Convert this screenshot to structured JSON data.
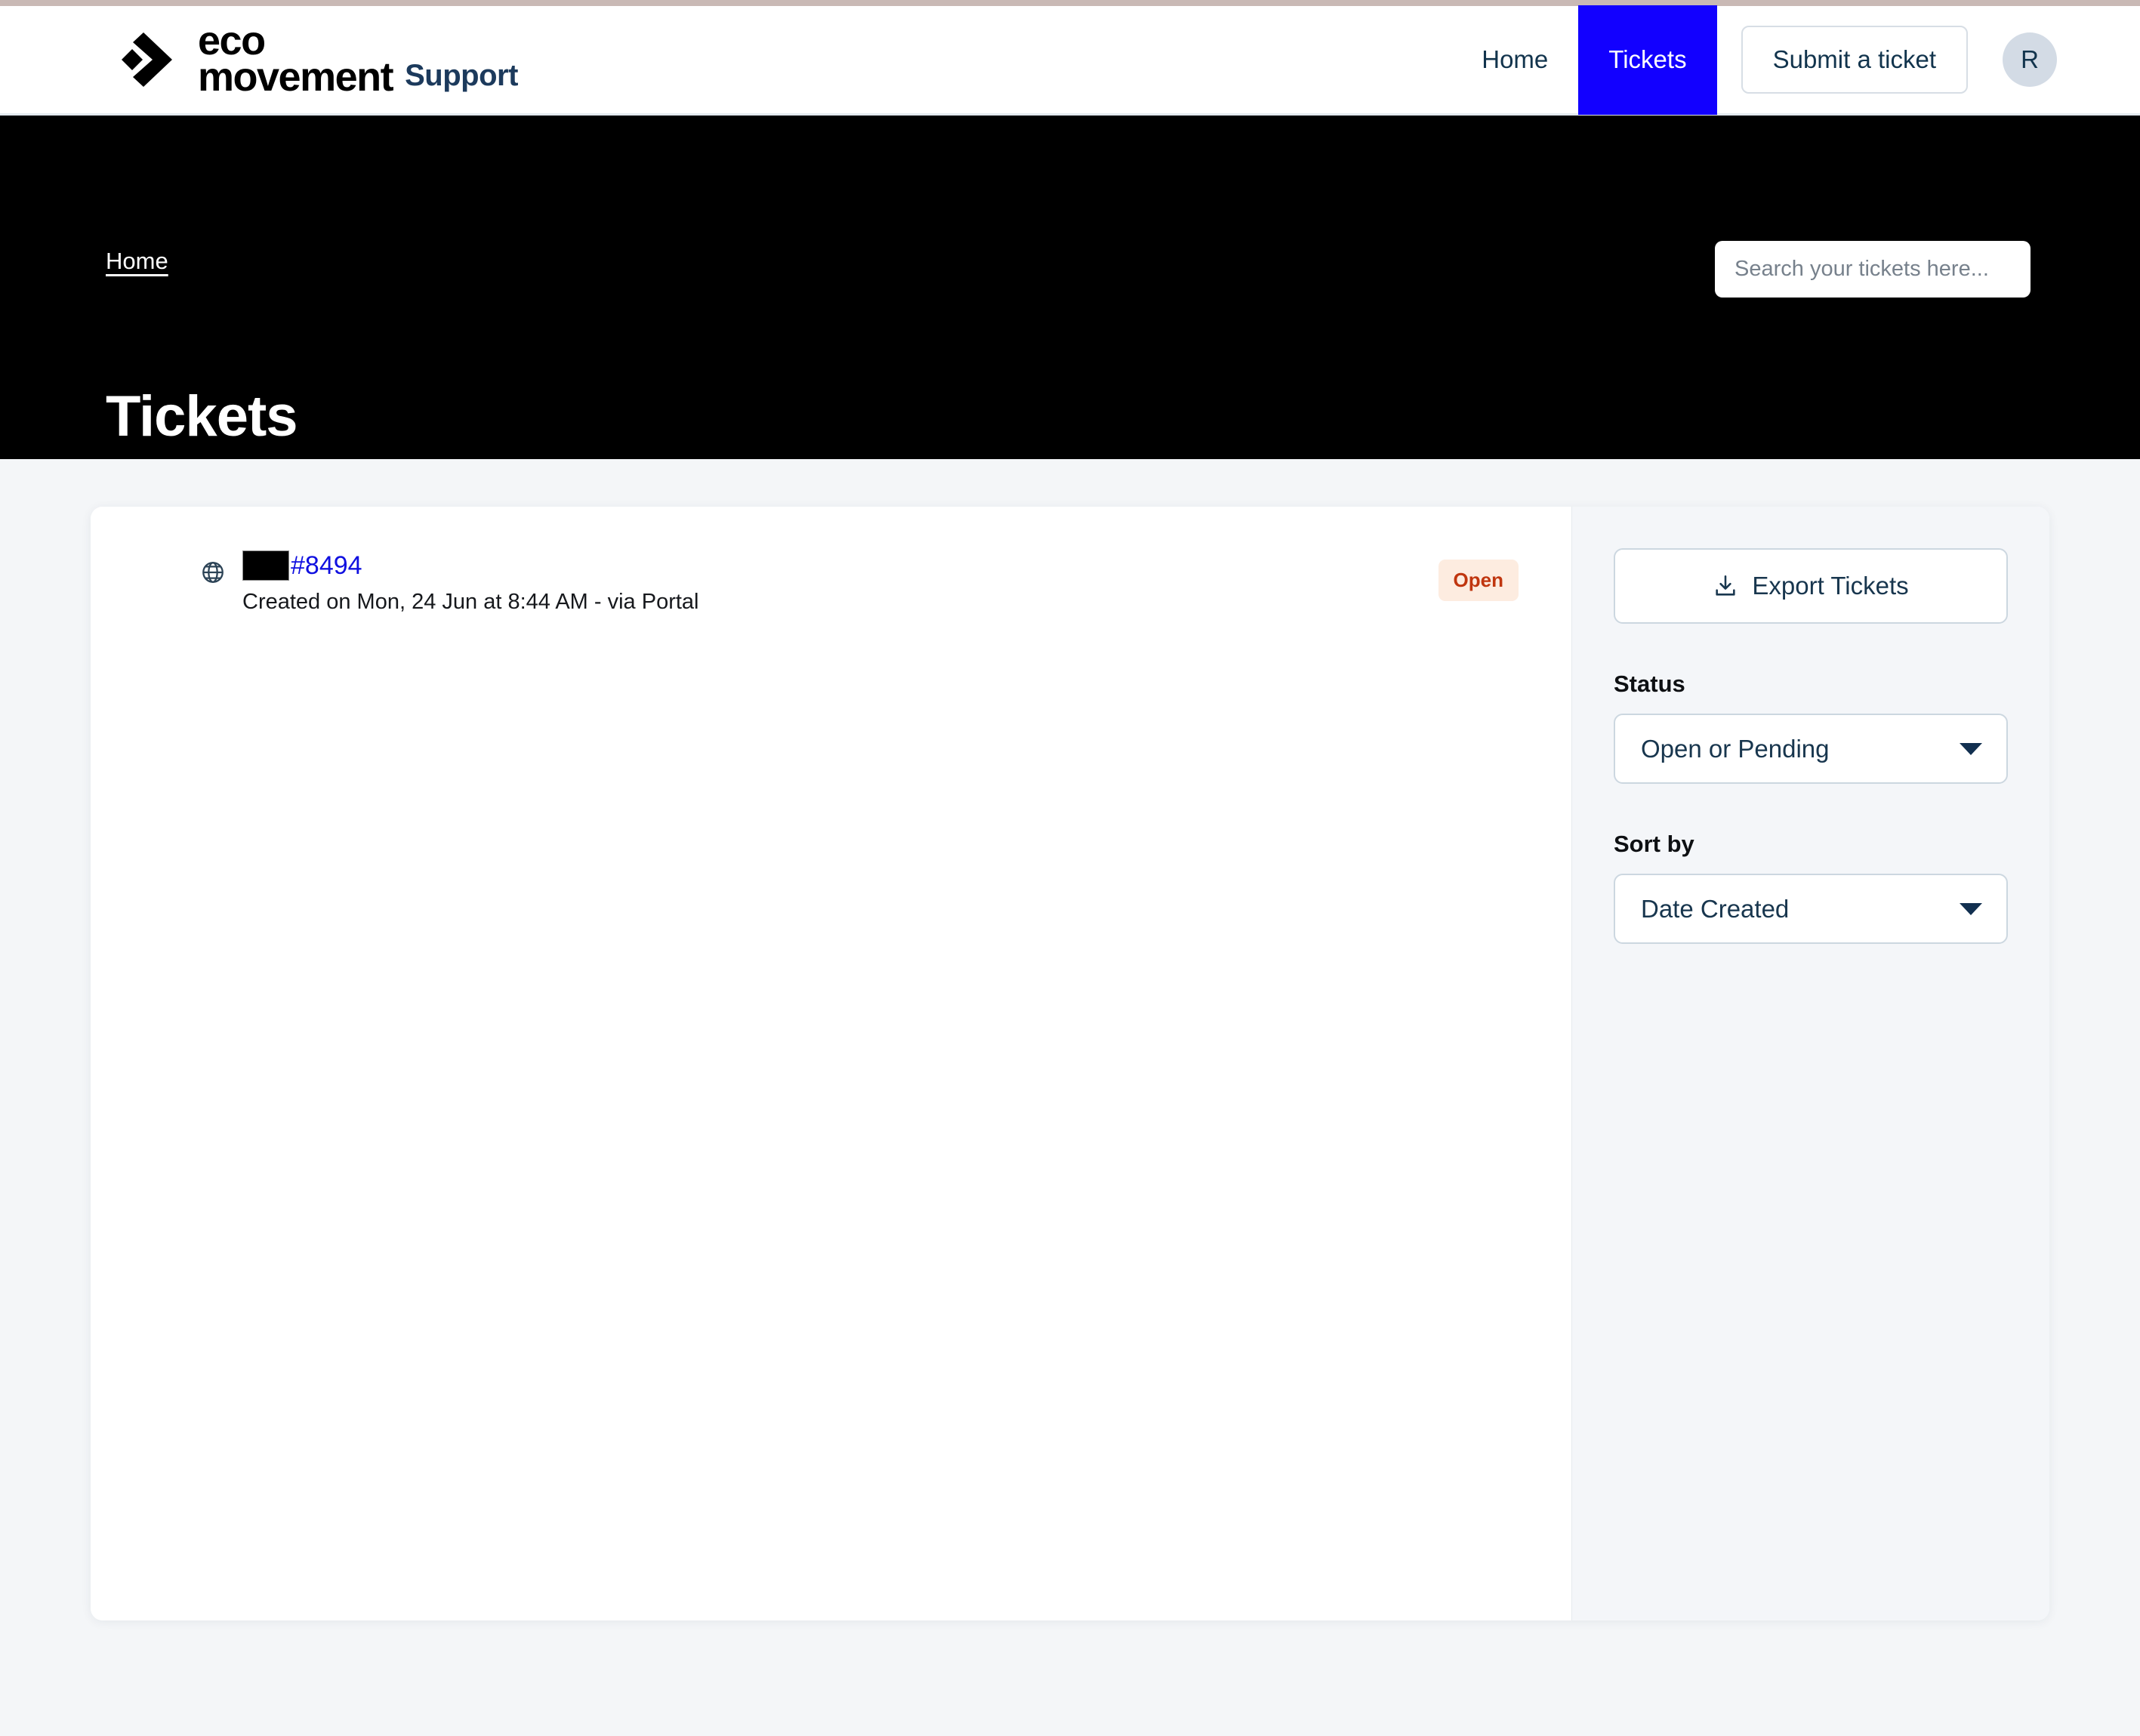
{
  "brand": {
    "logo_icon": "eco-movement-chevron-logo",
    "name_line1": "eco",
    "name_line2": "movement",
    "suffix": "Support"
  },
  "header": {
    "nav": [
      {
        "label": "Home",
        "active": false
      },
      {
        "label": "Tickets",
        "active": true
      }
    ],
    "submit_label": "Submit a ticket",
    "avatar_initial": "R"
  },
  "hero": {
    "breadcrumb": "Home",
    "title": "Tickets",
    "accent_bg": "#000000"
  },
  "search": {
    "placeholder": "Search your tickets here...",
    "value": "",
    "icon": "search-icon"
  },
  "tickets": [
    {
      "channel_icon": "globe-icon",
      "subject_redacted": true,
      "id": "#8494",
      "meta": "Created on Mon, 24 Jun at 8:44 AM - via Portal",
      "status": "Open"
    }
  ],
  "sidebar": {
    "export_label": "Export Tickets",
    "export_icon": "download-icon",
    "status_label": "Status",
    "status_value": "Open or Pending",
    "sort_label": "Sort by",
    "sort_value": "Date Created"
  },
  "colors": {
    "accent_blue": "#1200ff",
    "link_blue": "#1010e0",
    "status_text": "#c0360f",
    "status_bg": "#fdece0",
    "navy": "#12344d"
  }
}
